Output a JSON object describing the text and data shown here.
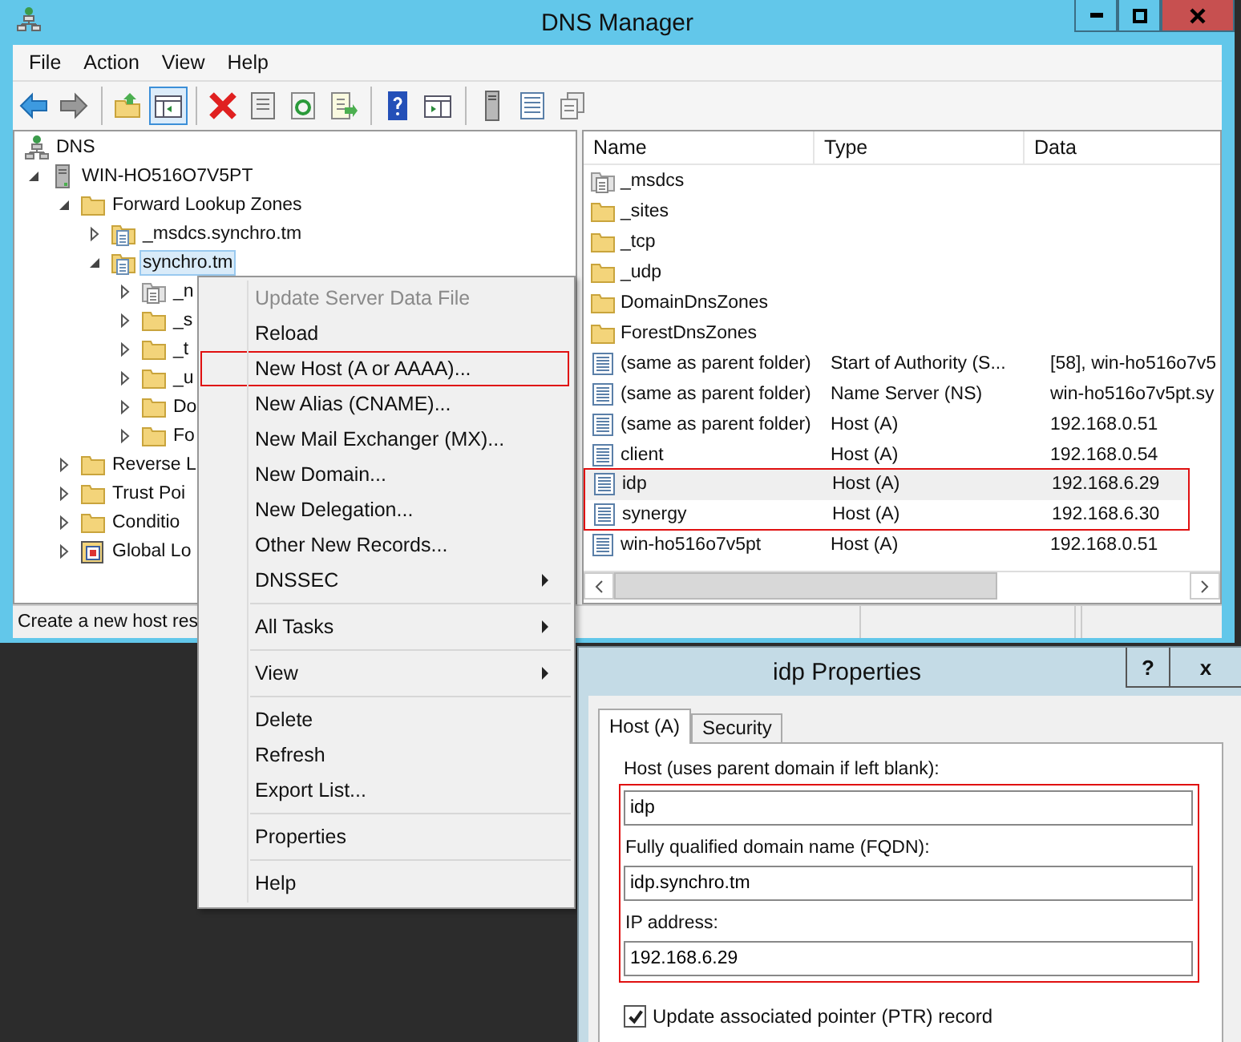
{
  "window": {
    "title": "DNS Manager"
  },
  "menu_bar": [
    "File",
    "Action",
    "View",
    "Help"
  ],
  "toolbar": [
    {
      "kind": "back",
      "pressed": false
    },
    {
      "kind": "forward",
      "pressed": false
    },
    {
      "kind": "separator"
    },
    {
      "kind": "up",
      "pressed": false
    },
    {
      "kind": "console-tree",
      "pressed": true
    },
    {
      "kind": "separator"
    },
    {
      "kind": "delete",
      "pressed": false
    },
    {
      "kind": "properties",
      "pressed": false
    },
    {
      "kind": "refresh",
      "pressed": false
    },
    {
      "kind": "export",
      "pressed": false
    },
    {
      "kind": "separator"
    },
    {
      "kind": "help",
      "pressed": false
    },
    {
      "kind": "action-pane",
      "pressed": false
    },
    {
      "kind": "separator"
    },
    {
      "kind": "server",
      "pressed": false
    },
    {
      "kind": "list",
      "pressed": false
    },
    {
      "kind": "copy",
      "pressed": false
    }
  ],
  "tree": [
    {
      "label": "DNS",
      "kind": "dns",
      "selected": false,
      "children": [
        {
          "label": "WIN-HO516O7V5PT",
          "kind": "server",
          "expanded": true,
          "selected": false,
          "children": [
            {
              "label": "Forward Lookup Zones",
              "kind": "folder",
              "expanded": true,
              "selected": false,
              "children": [
                {
                  "label": "_msdcs.synchro.tm",
                  "kind": "zone",
                  "expanded": false,
                  "selected": false
                },
                {
                  "label": "synchro.tm",
                  "kind": "zone",
                  "expanded": true,
                  "selected": true,
                  "children": [
                    {
                      "label": "_n",
                      "kind": "zone-grey",
                      "expanded": false,
                      "selected": false
                    },
                    {
                      "label": "_s",
                      "kind": "folder",
                      "expanded": false,
                      "selected": false
                    },
                    {
                      "label": "_t",
                      "kind": "folder",
                      "expanded": false,
                      "selected": false
                    },
                    {
                      "label": "_u",
                      "kind": "folder",
                      "expanded": false,
                      "selected": false
                    },
                    {
                      "label": "Do",
                      "kind": "folder",
                      "expanded": false,
                      "selected": false
                    },
                    {
                      "label": "Fo",
                      "kind": "folder",
                      "expanded": false,
                      "selected": false
                    }
                  ]
                }
              ]
            },
            {
              "label": "Reverse L",
              "kind": "folder",
              "expanded": false,
              "selected": false
            },
            {
              "label": "Trust Poi",
              "kind": "folder",
              "expanded": false,
              "selected": false
            },
            {
              "label": "Conditio",
              "kind": "folder",
              "expanded": false,
              "selected": false
            },
            {
              "label": "Global Lo",
              "kind": "global",
              "expanded": false,
              "selected": false
            }
          ]
        }
      ]
    }
  ],
  "list": {
    "columns": [
      "Name",
      "Type",
      "Data"
    ],
    "rows": [
      {
        "kind": "zone-grey",
        "name": "_msdcs",
        "selected": false,
        "flagged": false
      },
      {
        "kind": "folder",
        "name": "_sites",
        "selected": false,
        "flagged": false
      },
      {
        "kind": "folder",
        "name": "_tcp",
        "selected": false,
        "flagged": false
      },
      {
        "kind": "folder",
        "name": "_udp",
        "selected": false,
        "flagged": false
      },
      {
        "kind": "folder",
        "name": "DomainDnsZones",
        "selected": false,
        "flagged": false
      },
      {
        "kind": "folder",
        "name": "ForestDnsZones",
        "selected": false,
        "flagged": false
      },
      {
        "kind": "record",
        "name": "(same as parent folder)",
        "type": "Start of Authority (S...",
        "data": "[58], win-ho516o7v5",
        "selected": false,
        "flagged": false
      },
      {
        "kind": "record",
        "name": "(same as parent folder)",
        "type": "Name Server (NS)",
        "data": "win-ho516o7v5pt.sy",
        "selected": false,
        "flagged": false
      },
      {
        "kind": "record",
        "name": "(same as parent folder)",
        "type": "Host (A)",
        "data": "192.168.0.51",
        "selected": false,
        "flagged": false
      },
      {
        "kind": "record",
        "name": "client",
        "type": "Host (A)",
        "data": "192.168.0.54",
        "selected": false,
        "flagged": false
      },
      {
        "kind": "record",
        "name": "idp",
        "type": "Host (A)",
        "data": "192.168.6.29",
        "selected": true,
        "flagged": true
      },
      {
        "kind": "record",
        "name": "synergy",
        "type": "Host (A)",
        "data": "192.168.6.30",
        "selected": false,
        "flagged": true
      },
      {
        "kind": "record",
        "name": "win-ho516o7v5pt",
        "type": "Host (A)",
        "data": "192.168.0.51",
        "selected": false,
        "flagged": false
      }
    ]
  },
  "status_bar": "Create a new host res",
  "context_menu": [
    [
      {
        "label": "Update Server Data File",
        "disabled": true,
        "submenu": false,
        "flagged": false
      },
      {
        "label": "Reload",
        "disabled": false,
        "submenu": false,
        "flagged": false
      },
      {
        "label": "New Host (A or AAAA)...",
        "disabled": false,
        "submenu": false,
        "flagged": true
      },
      {
        "label": "New Alias (CNAME)...",
        "disabled": false,
        "submenu": false,
        "flagged": false
      },
      {
        "label": "New Mail Exchanger (MX)...",
        "disabled": false,
        "submenu": false,
        "flagged": false
      },
      {
        "label": "New Domain...",
        "disabled": false,
        "submenu": false,
        "flagged": false
      },
      {
        "label": "New Delegation...",
        "disabled": false,
        "submenu": false,
        "flagged": false
      },
      {
        "label": "Other New Records...",
        "disabled": false,
        "submenu": false,
        "flagged": false
      },
      {
        "label": "DNSSEC",
        "disabled": false,
        "submenu": true,
        "flagged": false
      }
    ],
    [
      {
        "label": "All Tasks",
        "disabled": false,
        "submenu": true,
        "flagged": false
      }
    ],
    [
      {
        "label": "View",
        "disabled": false,
        "submenu": true,
        "flagged": false
      }
    ],
    [
      {
        "label": "Delete",
        "disabled": false,
        "submenu": false,
        "flagged": false
      },
      {
        "label": "Refresh",
        "disabled": false,
        "submenu": false,
        "flagged": false
      },
      {
        "label": "Export List...",
        "disabled": false,
        "submenu": false,
        "flagged": false
      }
    ],
    [
      {
        "label": "Properties",
        "disabled": false,
        "submenu": false,
        "flagged": false
      }
    ],
    [
      {
        "label": "Help",
        "disabled": false,
        "submenu": false,
        "flagged": false
      }
    ]
  ],
  "dialog": {
    "title": "idp Properties",
    "title_buttons": [
      "?",
      "x"
    ],
    "tabs": [
      {
        "label": "Host (A)",
        "selected": true
      },
      {
        "label": "Security",
        "selected": false
      }
    ],
    "fields": [
      {
        "label": "Host (uses parent domain if left blank):",
        "value": "idp"
      },
      {
        "label": "Fully qualified domain name (FQDN):",
        "value": "idp.synchro.tm"
      },
      {
        "label": "IP address:",
        "value": "192.168.6.29"
      }
    ],
    "checkbox": {
      "label": "Update associated pointer (PTR) record",
      "checked": true
    }
  }
}
